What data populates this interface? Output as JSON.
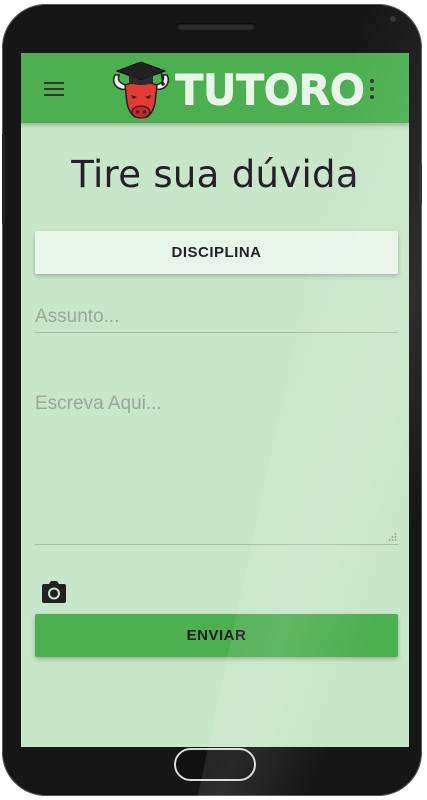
{
  "app": {
    "logo_text": "TUTORO"
  },
  "appbar": {
    "menu_icon": "hamburger-menu-icon",
    "more_icon": "more-vert-icon"
  },
  "page": {
    "title": "Tire sua dúvida"
  },
  "form": {
    "discipline_button_label": "DISCIPLINA",
    "subject": {
      "value": "",
      "placeholder": "Assunto..."
    },
    "body": {
      "value": "",
      "placeholder": "Escreva Aqui..."
    },
    "attach_icon": "camera-icon",
    "send_button_label": "ENVIAR"
  },
  "colors": {
    "appbar": "#4caf50",
    "screen_background": "#c8e6c9",
    "send_button": "#4caf50",
    "discipline_button": "#e8f5e9",
    "logo_red": "#e53935"
  }
}
